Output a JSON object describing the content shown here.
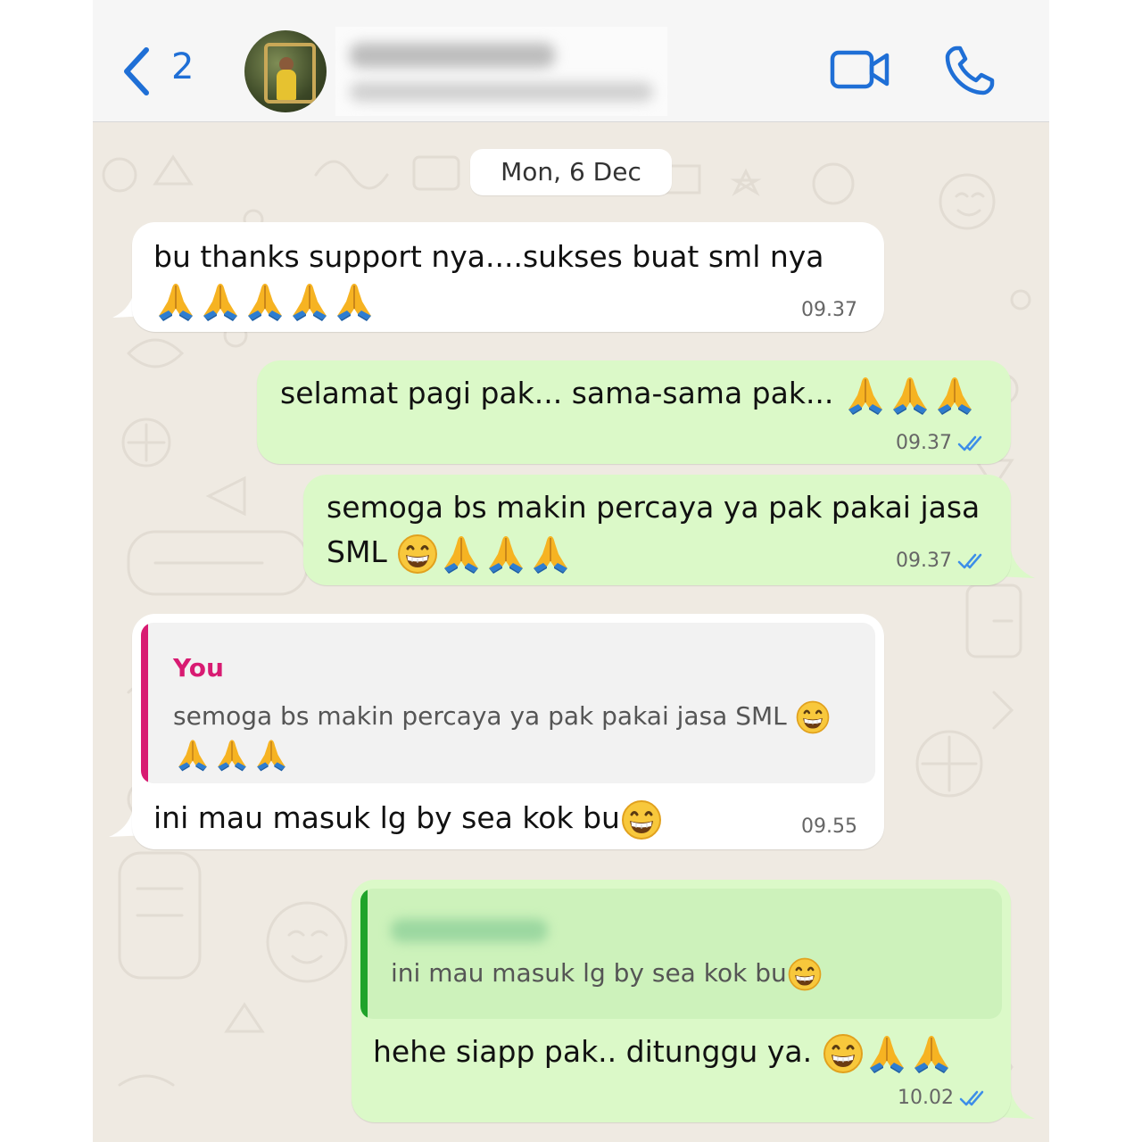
{
  "header": {
    "back_count": "2",
    "contact_name": "",
    "contact_status": ""
  },
  "chat": {
    "date_separator": "Mon, 6 Dec",
    "messages": [
      {
        "direction": "incoming",
        "text": "bu thanks support nya....sukses buat sml nya",
        "emoji": "🙏🙏🙏🙏🙏",
        "time": "09.37"
      },
      {
        "direction": "outgoing",
        "text": "selamat pagi pak... sama-sama pak...",
        "emoji": "🙏🙏🙏",
        "time": "09.37",
        "status": "read"
      },
      {
        "direction": "outgoing",
        "text_line1": "semoga bs makin percaya ya pak pakai jasa",
        "text_line2": "SML",
        "emoji": "😁🙏🙏🙏",
        "time": "09.37",
        "status": "read"
      },
      {
        "direction": "incoming",
        "quote_author": "You",
        "quote_text": "semoga bs makin percaya ya pak pakai jasa SML",
        "quote_emoji": "😁🙏🙏🙏",
        "text": "ini mau masuk lg by sea kok bu",
        "emoji": "😁",
        "time": "09.55"
      },
      {
        "direction": "outgoing",
        "quote_author": "",
        "quote_text": "ini mau masuk lg by sea kok bu",
        "quote_emoji": "😁",
        "text": "hehe siapp pak.. ditunggu ya.",
        "emoji": "😁🙏🙏",
        "time": "10.02",
        "status": "read"
      }
    ]
  },
  "colors": {
    "accent_blue": "#1f6fd6",
    "incoming_bubble": "#ffffff",
    "outgoing_bubble": "#dbf9c8",
    "quote_you_bar": "#d81b72",
    "quote_contact_bar": "#1fa32a",
    "read_tick": "#3d8ee8",
    "wallpaper": "#efeae2"
  },
  "icons": [
    "back-chevron-icon",
    "video-call-icon",
    "phone-call-icon",
    "double-tick-icon",
    "folded-hands-emoji",
    "grinning-emoji"
  ]
}
